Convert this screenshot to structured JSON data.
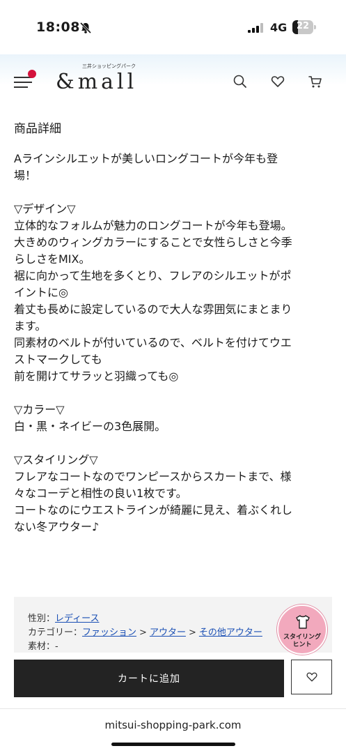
{
  "status_bar": {
    "time": "18:08",
    "network": "4G",
    "battery": "22"
  },
  "header": {
    "logo": "&mall",
    "logo_sub": "三井ショッピングパーク"
  },
  "section_title": "商品詳細",
  "description_lines": [
    "Aラインシルエットが美しいロングコートが今年も登",
    "場！",
    "",
    "▽デザイン▽",
    "立体的なフォルムが魅力のロングコートが今年も登場。",
    "大きめのウィングカラーにすることで女性らしさと今季",
    "らしさをMIX。",
    "裾に向かって生地を多くとり、フレアのシルエットがポ",
    "イントに◎",
    "着丈も長めに設定しているので大人な雰囲気にまとまり",
    "ます。",
    "同素材のベルトが付いているので、ベルトを付けてウエ",
    "ストマークしても",
    "前を開けてサラッと羽織っても◎",
    "",
    "▽カラー▽",
    "白・黒・ネイビーの3色展開。",
    "",
    "▽スタイリング▽",
    "フレアなコートなのでワンピースからスカートまで、様",
    "々なコーデと相性の良い1枚です。",
    "コートなのにウエストラインが綺麗に見え、着ぶくれし",
    "ない冬アウター♪"
  ],
  "meta": {
    "gender_label": "性別：",
    "gender_value": "レディース",
    "category_label": "カテゴリー：",
    "categories": [
      "ファッション",
      "アウター",
      "その他アウター"
    ],
    "category_sep": ">",
    "material_label": "素材：-"
  },
  "badge": {
    "label": "スタイリング\nヒント"
  },
  "actions": {
    "add_to_cart": "カートに追加"
  },
  "browser": {
    "url": "mitsui-shopping-park.com"
  }
}
